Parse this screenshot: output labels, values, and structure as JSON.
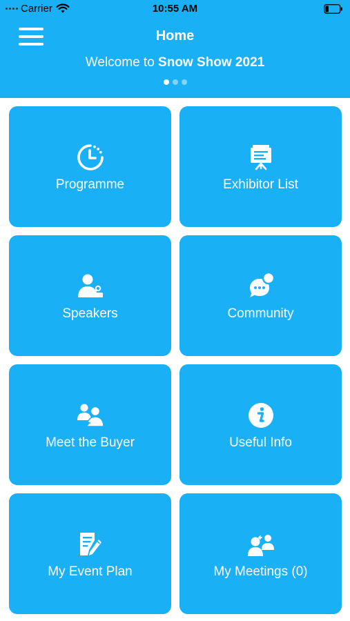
{
  "status_bar": {
    "carrier": "Carrier",
    "time": "10:55 AM"
  },
  "header": {
    "title": "Home",
    "welcome_prefix": "Welcome to ",
    "welcome_event": "Snow Show 2021",
    "pager": {
      "pages": 3,
      "current": 1
    }
  },
  "tiles": [
    {
      "label": "Programme",
      "icon": "clock-icon"
    },
    {
      "label": "Exhibitor List",
      "icon": "presentation-board-icon"
    },
    {
      "label": "Speakers",
      "icon": "speaker-icon"
    },
    {
      "label": "Community",
      "icon": "chat-bubble-icon"
    },
    {
      "label": "Meet the Buyer",
      "icon": "buyers-icon"
    },
    {
      "label": "Useful Info",
      "icon": "info-icon"
    },
    {
      "label": "My Event Plan",
      "icon": "edit-document-icon"
    },
    {
      "label": "My Meetings (0)",
      "icon": "meeting-users-icon"
    }
  ],
  "colors": {
    "primary": "#1ab0f5",
    "text": "#ffffff"
  }
}
